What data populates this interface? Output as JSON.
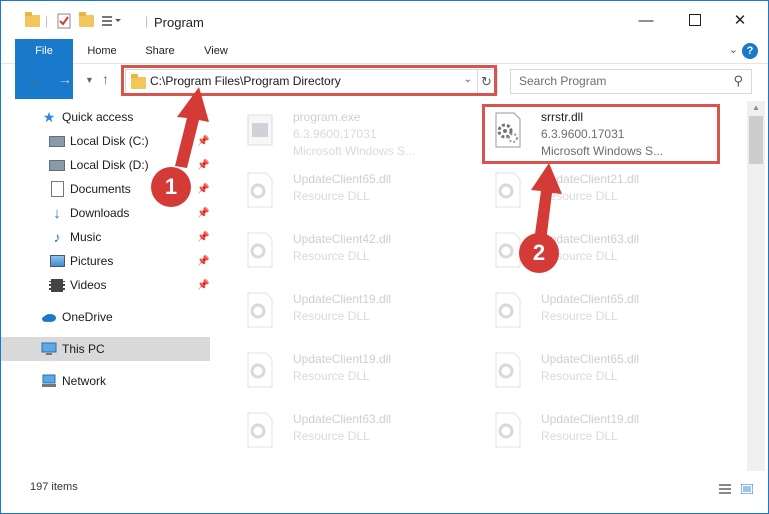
{
  "window": {
    "title": "Program"
  },
  "ribbon": {
    "tabs": [
      {
        "label": "File"
      },
      {
        "label": "Home"
      },
      {
        "label": "Share"
      },
      {
        "label": "View"
      }
    ]
  },
  "address": {
    "path": "C:\\Program Files\\Program Directory"
  },
  "search": {
    "placeholder": "Search Program"
  },
  "sidebar": {
    "items": [
      {
        "label": "Quick access",
        "icon": "star-icon"
      },
      {
        "label": "Local Disk (C:)",
        "icon": "drive-icon"
      },
      {
        "label": "Local Disk (D:)",
        "icon": "drive-icon"
      },
      {
        "label": "Documents",
        "icon": "documents-icon"
      },
      {
        "label": "Downloads",
        "icon": "download-arrow-icon"
      },
      {
        "label": "Music",
        "icon": "music-note-icon"
      },
      {
        "label": "Pictures",
        "icon": "pictures-icon"
      },
      {
        "label": "Videos",
        "icon": "film-icon"
      },
      {
        "label": "OneDrive",
        "icon": "cloud-icon"
      },
      {
        "label": "This PC",
        "icon": "computer-icon"
      },
      {
        "label": "Network",
        "icon": "network-icon"
      }
    ]
  },
  "files": {
    "highlighted": {
      "name": "srrstr.dll",
      "version": "6.3.9600.17031",
      "company": "Microsoft Windows S..."
    },
    "program": {
      "name": "program.exe",
      "version": "6.3.9600.17031",
      "company": "Microsoft Windows S..."
    },
    "faded": [
      {
        "name": "UpdateClient65.dll",
        "type": "Resource DLL"
      },
      {
        "name": "UpdateClient21.dll",
        "type": "Resource DLL"
      },
      {
        "name": "UpdateClient42.dll",
        "type": "Resource DLL"
      },
      {
        "name": "UpdateClient63.dll",
        "type": "Resource DLL"
      },
      {
        "name": "UpdateClient19.dll",
        "type": "Resource DLL"
      },
      {
        "name": "UpdateClient65.dll",
        "type": "Resource DLL"
      },
      {
        "name": "UpdateClient19.dll",
        "type": "Resource DLL"
      },
      {
        "name": "UpdateClient65.dll",
        "type": "Resource DLL"
      },
      {
        "name": "UpdateClient63.dll",
        "type": "Resource DLL"
      },
      {
        "name": "UpdateClient19.dll",
        "type": "Resource DLL"
      }
    ]
  },
  "status": {
    "item_count": "197 items"
  },
  "callouts": {
    "one": "1",
    "two": "2"
  },
  "colors": {
    "accent": "#1979ca",
    "annotation": "#d43a36"
  }
}
